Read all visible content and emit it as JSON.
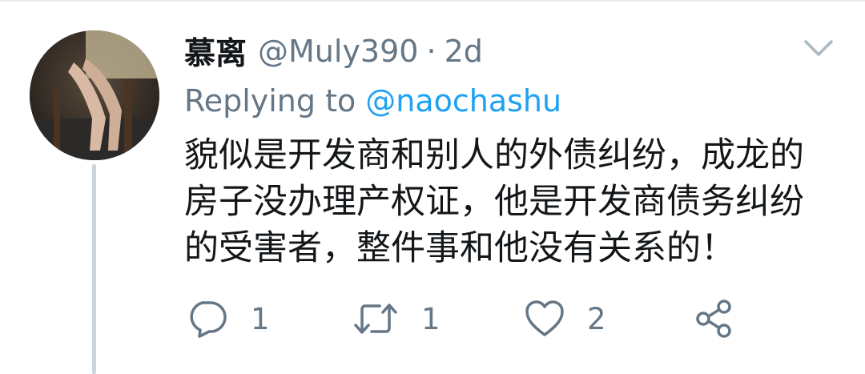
{
  "tweet": {
    "display_name": "慕离",
    "handle": "@Muly390",
    "separator": "·",
    "time": "2d",
    "replying_label": "Replying to",
    "replying_to": "@naochashu",
    "text_lines": [
      "貌似是开发商和别人的外债纠纷，成龙的",
      "房子没办理产权证，他是开发商债务纠纷",
      "的受害者，整件事和他没有关系的！"
    ]
  },
  "actions": {
    "reply": {
      "icon": "reply-icon",
      "count": "1"
    },
    "retweet": {
      "icon": "retweet-icon",
      "count": "1"
    },
    "like": {
      "icon": "heart-icon",
      "count": "2"
    },
    "share": {
      "icon": "share-icon"
    }
  },
  "menu": {
    "icon": "chevron-down-icon"
  },
  "colors": {
    "text_primary": "#14171a",
    "text_secondary": "#657786",
    "link": "#1da1f2",
    "thread_line": "#ccd6dd"
  }
}
